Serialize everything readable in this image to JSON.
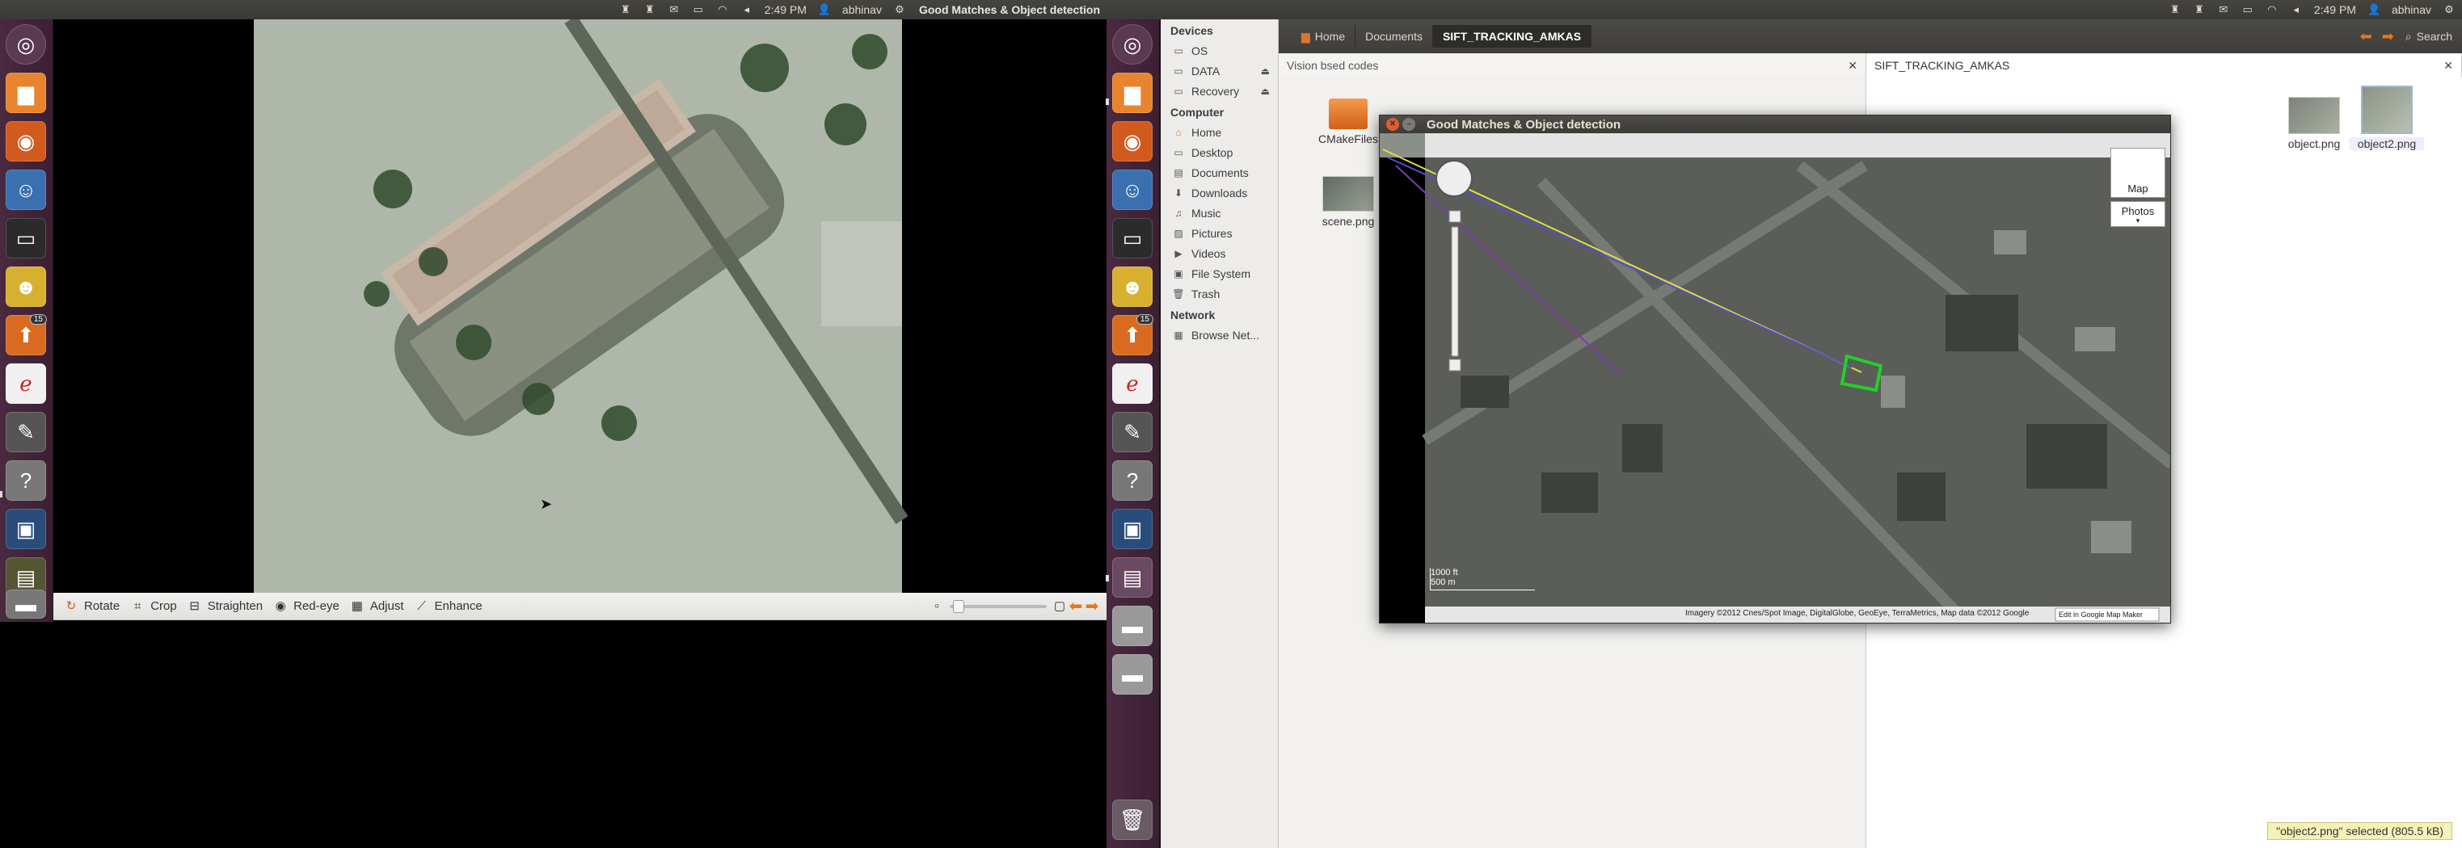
{
  "top_panel_left": {
    "time": "2:49 PM",
    "user": "abhinav",
    "window_title": "Good Matches & Object detection"
  },
  "top_panel_right": {
    "time": "2:49 PM",
    "user": "abhinav"
  },
  "photo_toolbar": {
    "tools": [
      {
        "label": "Rotate",
        "icon": "rotate-icon"
      },
      {
        "label": "Crop",
        "icon": "crop-icon"
      },
      {
        "label": "Straighten",
        "icon": "straighten-icon"
      },
      {
        "label": "Red-eye",
        "icon": "red-eye-icon"
      },
      {
        "label": "Adjust",
        "icon": "adjust-icon"
      },
      {
        "label": "Enhance",
        "icon": "enhance-icon"
      }
    ]
  },
  "launcher_badge": "15",
  "file_manager": {
    "breadcrumbs": [
      "Home",
      "Documents",
      "SIFT_TRACKING_AMKAS"
    ],
    "search_label": "Search",
    "sidebar": {
      "devices_heading": "Devices",
      "devices": [
        "OS",
        "DATA",
        "Recovery"
      ],
      "computer_heading": "Computer",
      "computer": [
        "Home",
        "Desktop",
        "Documents",
        "Downloads",
        "Music",
        "Pictures",
        "Videos",
        "File System",
        "Trash"
      ],
      "network_heading": "Network",
      "network": [
        "Browse Net..."
      ]
    },
    "pane_left_title": "Vision bsed codes",
    "pane_right_title": "SIFT_TRACKING_AMKAS",
    "files": [
      "CMakeFiles",
      "scene.png",
      "object.png",
      "object2.png"
    ],
    "status": "\"object2.png\" selected (805.5 kB)"
  },
  "opencv_window": {
    "title": "Good Matches & Object detection",
    "map_button": "Map",
    "photos_button": "Photos",
    "scale_ft": "1000 ft",
    "scale_m": "500 m",
    "attribution": "Imagery ©2012 Cnes/Spot Image, DigitalGlobe, GeoEye, TerraMetrics, Map data ©2012 Google",
    "edit_link": "Edit in Google Map Maker"
  },
  "colors": {
    "panel": "#3c3b37",
    "launcher": "#43253b",
    "match_box": "#22d02a",
    "match_line_yellow": "#e0e040",
    "match_line_blue": "#5a4bd0"
  }
}
